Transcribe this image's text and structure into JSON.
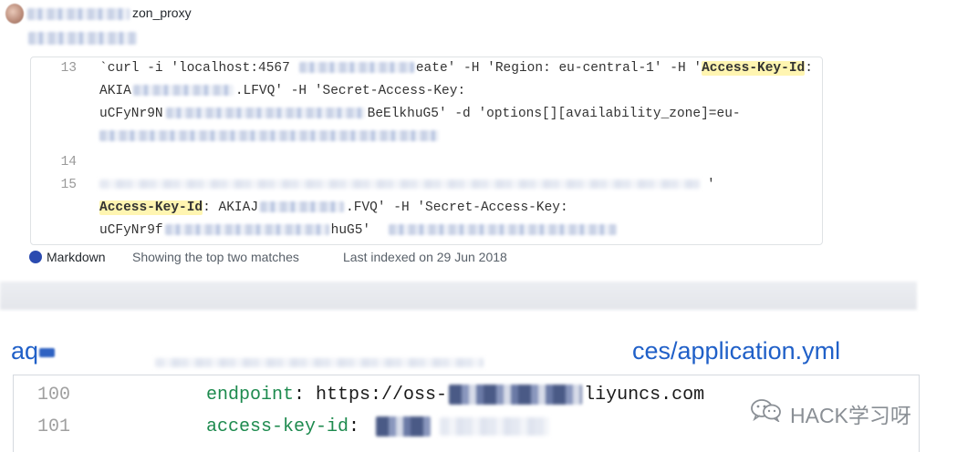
{
  "header": {
    "repo_name_visible": "zon_proxy"
  },
  "result1": {
    "lines": [
      {
        "num": "13",
        "parts": [
          "`curl -i 'localhost:4567",
          "eate' -H 'Region: eu-central-1' -H '",
          "Access-Key-Id",
          ":"
        ]
      },
      {
        "num": "",
        "parts": [
          "AKIA",
          ".LFVQ' -H 'Secret-Access-Key:"
        ]
      },
      {
        "num": "",
        "parts": [
          "uCFyNr9N",
          "BeElkhuG5' -d 'options[][availability_zone]=eu-"
        ]
      },
      {
        "num": "",
        "parts": []
      },
      {
        "num": "14",
        "parts": []
      },
      {
        "num": "15",
        "parts": [
          "'"
        ]
      },
      {
        "num": "",
        "parts": [
          "Access-Key-Id",
          ": AKIAJ",
          ".FVQ' -H 'Secret-Access-Key:"
        ]
      },
      {
        "num": "",
        "parts": [
          "uCFyNr9f",
          "huG5'"
        ]
      }
    ],
    "language": "Markdown",
    "language_color": "#2b4bb0",
    "matches_text": "Showing the top two matches",
    "indexed_text": "Last indexed on 29 Jun 2018"
  },
  "result2": {
    "repo_prefix": "aq",
    "file_path": "ces/application.yml",
    "lines": [
      {
        "num": "100",
        "key": "endpoint",
        "sep": ": ",
        "value_start": "https://oss-",
        "value_end": "liyuncs.com"
      },
      {
        "num": "101",
        "key": "access-key-id",
        "sep": ": ",
        "value_start": "",
        "value_end": ""
      }
    ]
  },
  "watermark": {
    "text": "HACK学习呀",
    "icon": "wechat-icon"
  },
  "colors": {
    "highlight": "#fff5b1",
    "link_blue": "#2060c8",
    "yaml_key": "#1d8a4e"
  }
}
